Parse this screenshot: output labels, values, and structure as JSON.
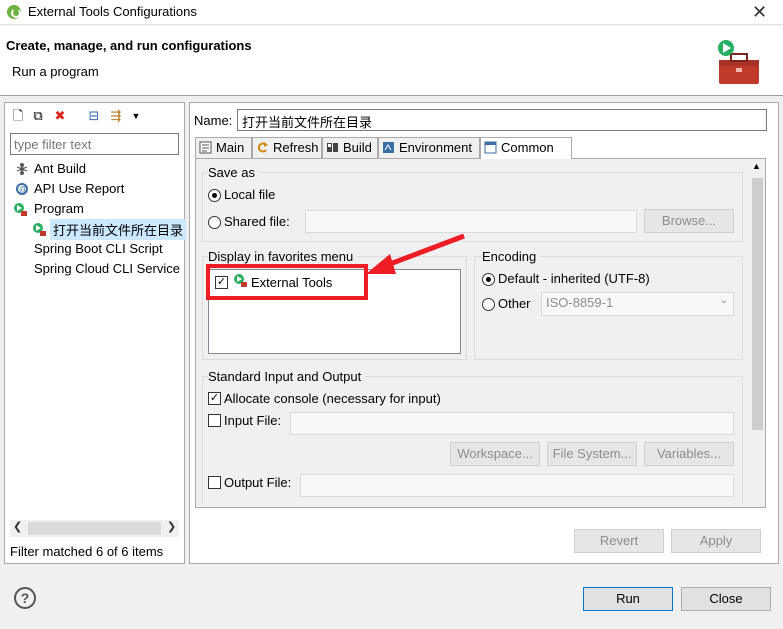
{
  "window": {
    "title": "External Tools Configurations",
    "close": "✕"
  },
  "header": {
    "title": "Create, manage, and run configurations",
    "subtitle": "Run a program"
  },
  "left": {
    "filter_placeholder": "type filter text",
    "items": [
      {
        "label": "Ant Build"
      },
      {
        "label": "API Use Report"
      },
      {
        "label": "Program"
      },
      {
        "label": "打开当前文件所在目录"
      },
      {
        "label": "Spring Boot CLI Script"
      },
      {
        "label": "Spring Cloud CLI Service"
      }
    ],
    "status": "Filter matched 6 of 6 items"
  },
  "config": {
    "name_label": "Name:",
    "name_value": "打开当前文件所在目录",
    "tabs": [
      "Main",
      "Refresh",
      "Build",
      "Environment",
      "Common"
    ],
    "save_as": {
      "label": "Save as",
      "local": "Local file",
      "shared": "Shared file:",
      "browse": "Browse..."
    },
    "favorites": {
      "label": "Display in favorites menu",
      "item": "External Tools"
    },
    "encoding": {
      "label": "Encoding",
      "default": "Default - inherited (UTF-8)",
      "other": "Other",
      "other_value": "ISO-8859-1"
    },
    "io": {
      "label": "Standard Input and Output",
      "allocate": "Allocate console (necessary for input)",
      "input": "Input File:",
      "output": "Output File:",
      "workspace": "Workspace...",
      "filesystem": "File System...",
      "variables": "Variables..."
    },
    "revert": "Revert",
    "apply": "Apply"
  },
  "footer": {
    "help": "?",
    "run": "Run",
    "close": "Close"
  },
  "colors": {
    "highlight": "#ee1c25",
    "accent": "#0078d7"
  }
}
